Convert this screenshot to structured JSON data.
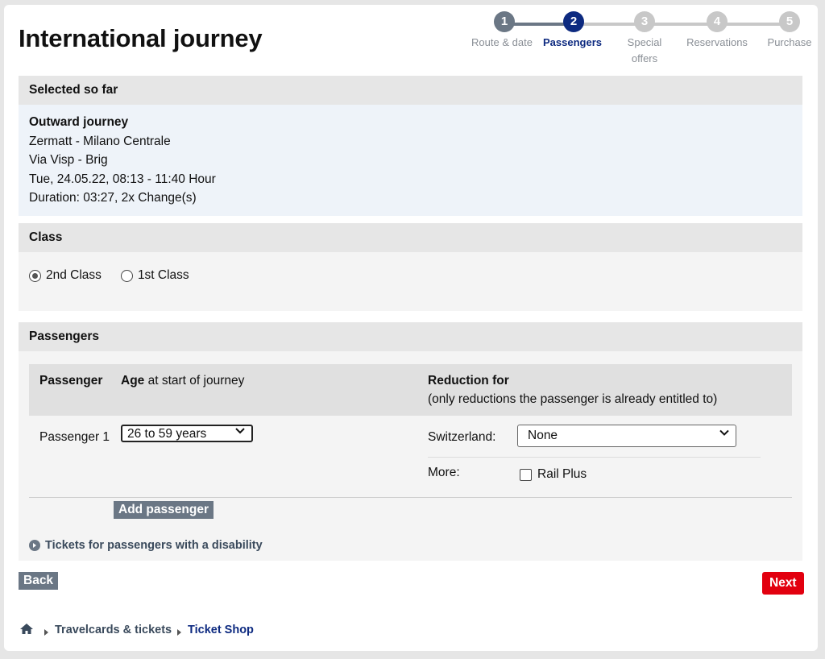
{
  "header": {
    "title": "International journey"
  },
  "stepper": {
    "steps": [
      {
        "num": "1",
        "label": "Route & date",
        "state": "done"
      },
      {
        "num": "2",
        "label": "Passengers",
        "state": "active"
      },
      {
        "num": "3",
        "label": "Special offers",
        "state": "todo"
      },
      {
        "num": "4",
        "label": "Reservations",
        "state": "todo"
      },
      {
        "num": "5",
        "label": "Purchase",
        "state": "todo"
      }
    ],
    "step3_line1": "Special",
    "step3_line2": "offers"
  },
  "summary": {
    "heading": "Selected so far",
    "journey_title": "Outward journey",
    "route": "Zermatt - Milano Centrale",
    "via": "Via Visp - Brig",
    "datetime": "Tue, 24.05.22, 08:13 - 11:40 Hour",
    "duration": "Duration: 03:27, 2x Change(s)"
  },
  "class_section": {
    "heading": "Class",
    "options": [
      {
        "label": "2nd Class",
        "selected": true
      },
      {
        "label": "1st Class",
        "selected": false
      }
    ]
  },
  "passengers_section": {
    "heading": "Passengers",
    "col_passenger": "Passenger",
    "col_age_bold": "Age",
    "col_age_rest": "at start of journey",
    "col_reduction": "Reduction for",
    "col_reduction_note": "(only reductions the passenger is already entitled to)",
    "rows": [
      {
        "name": "Passenger 1",
        "age": "26 to 59 years",
        "country_label": "Switzerland:",
        "reduction": "None",
        "more_label": "More:",
        "more_option": "Rail Plus",
        "more_checked": false
      }
    ],
    "add_button": "Add passenger",
    "disability_link": "Tickets for passengers with a disability"
  },
  "nav": {
    "back": "Back",
    "next": "Next"
  },
  "breadcrumb": {
    "items": [
      "Travelcards & tickets",
      "Ticket Shop"
    ]
  },
  "colors": {
    "step_done": "#6b7785",
    "step_active": "#0d2a80",
    "step_todo": "#c8c8c8",
    "next_button": "#e2000f",
    "link": "#0d2a80"
  }
}
